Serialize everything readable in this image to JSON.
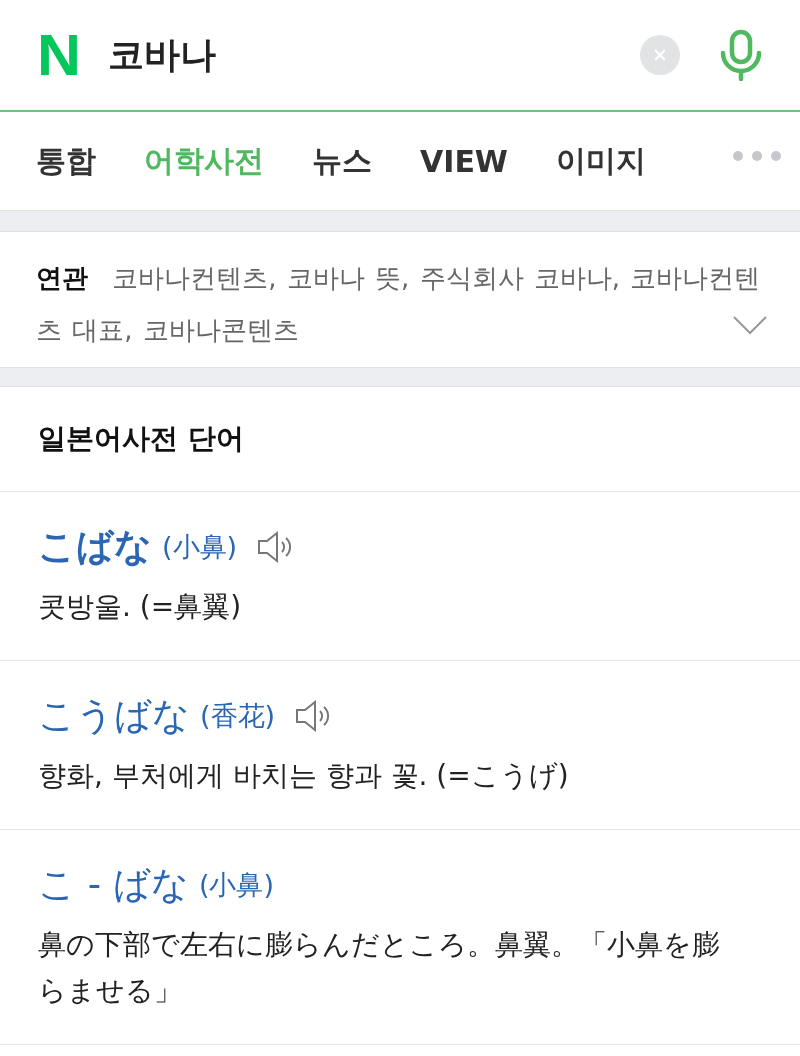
{
  "search": {
    "logo": "N",
    "query": "코바나"
  },
  "tabs": [
    {
      "label": "통합",
      "selected": false,
      "faded": false
    },
    {
      "label": "어학사전",
      "selected": true,
      "faded": false
    },
    {
      "label": "뉴스",
      "selected": false,
      "faded": false
    },
    {
      "label": "VIEW",
      "selected": false,
      "faded": false
    },
    {
      "label": "이미지",
      "selected": false,
      "faded": false
    }
  ],
  "related": {
    "text": "**연관** 코바나컨텐츠, 코바나 뜻, 주식회사 코바나, 코바나컨텐츠 대표, 코바나콘텐츠",
    "expanded": false
  },
  "section": {
    "title": "일본어사전 단어"
  },
  "entries": [
    {
      "word": "こばな",
      "kanji": "(小鼻)",
      "bold": true,
      "audio": true,
      "definition": "콧방울. (=鼻翼)"
    },
    {
      "word": "こうばな",
      "kanji": "(香花)",
      "bold": false,
      "audio": true,
      "definition": "향화, 부처에게 바치는 향과 꽃. (=こうげ)"
    },
    {
      "word": "こ - ばな",
      "kanji": "(小鼻)",
      "bold": false,
      "audio": false,
      "definition": "鼻の下部で左右に膨らんだところ。鼻翼。「小鼻を膨らませる」"
    }
  ]
}
